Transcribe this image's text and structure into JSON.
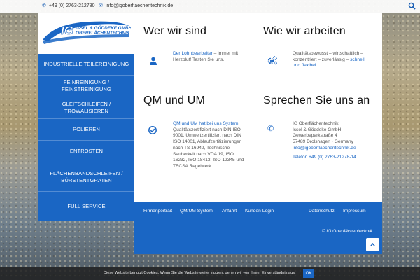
{
  "topbar": {
    "phone": "+49 (0) 2763-212780",
    "email": "info@igoberflaechentechnik.de"
  },
  "logo": {
    "mark": "IG",
    "line1": "ISSEL & GÖDDEKE GMBH",
    "line2": "OBERFLÄCHENTECHNIK"
  },
  "menu": [
    "Industrielle Teilereinigung",
    "Feinreinigung / Feinstreinigung",
    "Gleitschleifen / Trowalisieren",
    "Polieren",
    "Entrosten",
    "Flächenbandschleifen / Bürstentgraten",
    "Full Service"
  ],
  "sections": {
    "wer": {
      "title": "Wer wir sind",
      "link": "Der Lohnbearbeiter",
      "text_line1": " – immer mit",
      "text_line2": "Herzblut! Testen Sie uns."
    },
    "wie": {
      "title": "Wie wir arbeiten",
      "text_line1": "Qualitätsbewusst – wirtschaftlich –",
      "text_line2a": "konzentriert – zuverlässig – ",
      "link_a": "schnell",
      "link_b": "und flexibel"
    },
    "qm": {
      "title": "QM und UM",
      "link": "QM und UM hat bei uns System:",
      "lines": [
        "Qualitätszertifiziert nach DIN ISO",
        "9001, Umweltzertifiziert nach DIN",
        "ISO 14001, Ablaufzertifizierungen",
        "nach TS 16949, Technische",
        "Sauberkeit nach VDA 19, ISO",
        "16232, ISO 18413, ISO 12345 und",
        "TECSA Regelwerk."
      ]
    },
    "kontakt": {
      "title": "Sprechen Sie uns an",
      "lines": [
        "IG Oberflächentechnik",
        "Issel & Göddeke GmbH",
        "Gewerbeparkstraße 4",
        "57489 Drolshagen · Germany"
      ],
      "email": "info@igoberflaechentechnik.de",
      "phone": "Telefon +49 (0) 2763-21278-14"
    }
  },
  "footer": {
    "nav_left": [
      "Firmenportrait",
      "QM/UM-System",
      "Anfahrt",
      "Kunden-Login"
    ],
    "nav_right": [
      "Datenschutz",
      "Impressum"
    ],
    "copyright": "© IG Oberflächentechnik"
  },
  "cookie": {
    "message": "Diese Website benutzt Cookies. Wenn Sie die Website weiter nutzen, gehen wir von Ihrem Einverständnis aus.",
    "ok_label": "OK"
  },
  "colors": {
    "brand_blue": "#1a66c4"
  }
}
